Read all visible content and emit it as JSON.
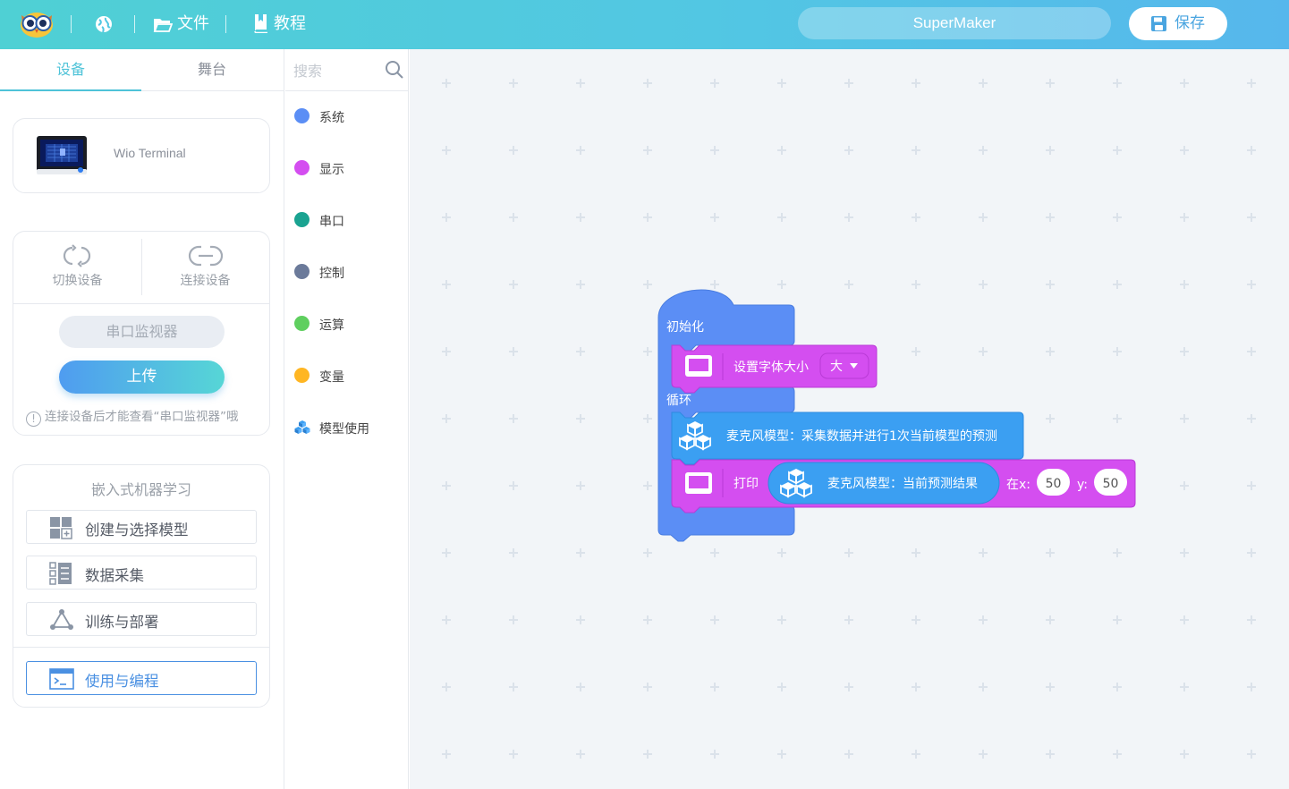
{
  "header": {
    "file_label": "文件",
    "tutorial_label": "教程",
    "project_name": "SuperMaker",
    "save_label": "保存",
    "gradient_colors": [
      "#4fd0d4",
      "#56b7ec"
    ]
  },
  "left_tabs": [
    "设备",
    "舞台"
  ],
  "device": {
    "name": "Wio Terminal"
  },
  "connection": {
    "switch_label": "切换设备",
    "connect_label": "连接设备",
    "serial_monitor_label": "串口监视器",
    "upload_label": "上传",
    "hint": "连接设备后才能查看“串口监视器”哦"
  },
  "ml": {
    "title": "嵌入式机器学习",
    "items": [
      {
        "label": "创建与选择模型",
        "icon": "model-grid-icon"
      },
      {
        "label": "数据采集",
        "icon": "data-collect-icon"
      },
      {
        "label": "训练与部署",
        "icon": "train-deploy-icon"
      },
      {
        "label": "使用与编程",
        "icon": "terminal-icon"
      }
    ]
  },
  "categories": {
    "search_placeholder": "搜索",
    "items": [
      {
        "label": "系统",
        "color": "#5b8ef5"
      },
      {
        "label": "显示",
        "color": "#d44ef0"
      },
      {
        "label": "串口",
        "color": "#1aa391"
      },
      {
        "label": "控制",
        "color": "#6b7a9a"
      },
      {
        "label": "运算",
        "color": "#5fcf5f"
      },
      {
        "label": "变量",
        "color": "#ffb623"
      },
      {
        "label": "模型使用",
        "icon": "cubes-icon"
      }
    ]
  },
  "blocks": {
    "init_label": "初始化",
    "set_font_label": "设置字体大小",
    "font_size_value": "大",
    "loop_label": "循环",
    "mic_collect_label": "麦克风模型：采集数据并进行1次当前模型的预测",
    "print_label": "打印",
    "mic_result_label": "麦克风模型：当前预测结果",
    "at_x_label": "在x:",
    "x_value": "50",
    "y_label": "y:",
    "y_value": "50",
    "colors": {
      "hat": "#5b8ef5",
      "display": "#d44ef0",
      "model": "#3b9ff2"
    }
  }
}
